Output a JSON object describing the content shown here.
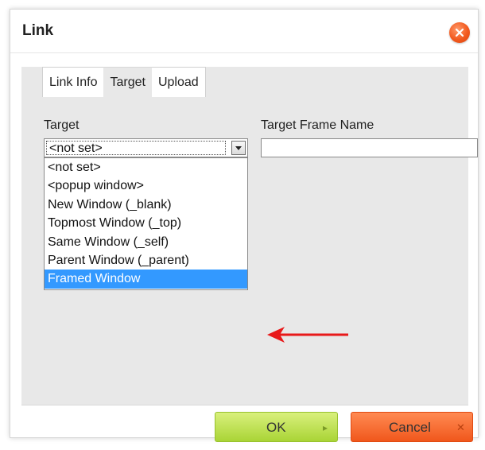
{
  "dialog": {
    "title": "Link"
  },
  "tabs": [
    {
      "label": "Link Info"
    },
    {
      "label": "Target"
    },
    {
      "label": "Upload"
    }
  ],
  "target": {
    "label": "Target",
    "selected_value": "<not set>",
    "options": [
      "<not set>",
      "<popup window>",
      "New Window (_blank)",
      "Topmost Window (_top)",
      "Same Window (_self)",
      "Parent Window (_parent)",
      "Framed Window"
    ],
    "highlighted_option": "Framed Window"
  },
  "frame_name": {
    "label": "Target Frame Name",
    "value": ""
  },
  "buttons": {
    "ok_label": "OK",
    "cancel_label": "Cancel",
    "ok_icon": "triangle-right-icon",
    "cancel_icon": "x-icon"
  },
  "colors": {
    "accent_green": "#a9d436",
    "accent_orange": "#f0571c",
    "highlight_blue": "#3399ff",
    "annotation_red": "#e8191a"
  }
}
